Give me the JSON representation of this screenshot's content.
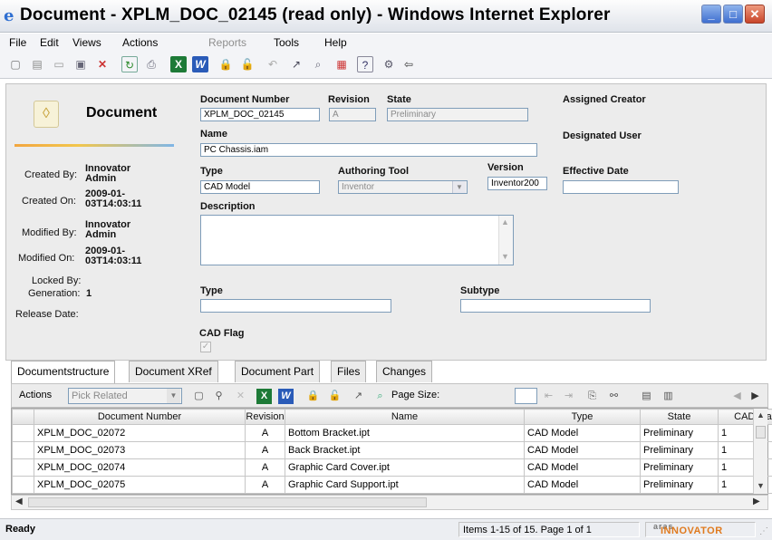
{
  "window": {
    "title": "Document - XPLM_DOC_02145 (read only) - Windows Internet Explorer"
  },
  "menu": {
    "items": [
      "File",
      "Edit",
      "Views",
      "Actions",
      "Reports",
      "Tools",
      "Help"
    ]
  },
  "form": {
    "heading": "Document",
    "doc_number_label": "Document Number",
    "doc_number": "XPLM_DOC_02145",
    "revision_label": "Revision",
    "revision": "A",
    "state_label": "State",
    "state": "Preliminary",
    "assigned_creator_label": "Assigned Creator",
    "name_label": "Name",
    "name": "PC Chassis.iam",
    "designated_user_label": "Designated User",
    "type_label": "Type",
    "type": "CAD Model",
    "authoring_tool_label": "Authoring Tool",
    "authoring_tool": "Inventor",
    "version_label": "Version",
    "version": "Inventor200",
    "effective_date_label": "Effective Date",
    "effective_date": "",
    "description_label": "Description",
    "description": "",
    "type2_label": "Type",
    "type2": "",
    "subtype_label": "Subtype",
    "subtype": "",
    "cad_flag_label": "CAD Flag",
    "created_by_label": "Created By:",
    "created_by_1": "Innovator",
    "created_by_2": "Admin",
    "created_on_label": "Created On:",
    "created_on_1": "2009-01-",
    "created_on_2": "03T14:03:11",
    "modified_by_label": "Modified By:",
    "modified_by_1": "Innovator",
    "modified_by_2": "Admin",
    "modified_on_label": "Modified On:",
    "modified_on_1": "2009-01-",
    "modified_on_2": "03T14:03:11",
    "locked_by_label": "Locked By:",
    "generation_label": "Generation:",
    "generation": "1",
    "release_date_label": "Release Date:"
  },
  "tabs": [
    "Documentstructure",
    "Document XRef",
    "Document Part",
    "Files",
    "Changes"
  ],
  "grid_toolbar": {
    "actions_label": "Actions",
    "pick_related": "Pick Related",
    "page_size_label": "Page Size:",
    "page_size": ""
  },
  "grid": {
    "columns": [
      "Document Number",
      "Revision",
      "Name",
      "Type",
      "State",
      "CAD Flag"
    ],
    "rows": [
      {
        "number": "XPLM_DOC_02072",
        "revision": "A",
        "name": "Bottom Bracket.ipt",
        "type": "CAD Model",
        "state": "Preliminary",
        "cad_flag": "1"
      },
      {
        "number": "XPLM_DOC_02073",
        "revision": "A",
        "name": "Back Bracket.ipt",
        "type": "CAD Model",
        "state": "Preliminary",
        "cad_flag": "1"
      },
      {
        "number": "XPLM_DOC_02074",
        "revision": "A",
        "name": "Graphic Card Cover.ipt",
        "type": "CAD Model",
        "state": "Preliminary",
        "cad_flag": "1"
      },
      {
        "number": "XPLM_DOC_02075",
        "revision": "A",
        "name": "Graphic Card Support.ipt",
        "type": "CAD Model",
        "state": "Preliminary",
        "cad_flag": "1"
      }
    ]
  },
  "status": {
    "text": "Ready",
    "items_info": "Items 1-15 of 15. Page 1 of 1",
    "brand": "INNOVATOR",
    "brand_prefix": "aras"
  }
}
